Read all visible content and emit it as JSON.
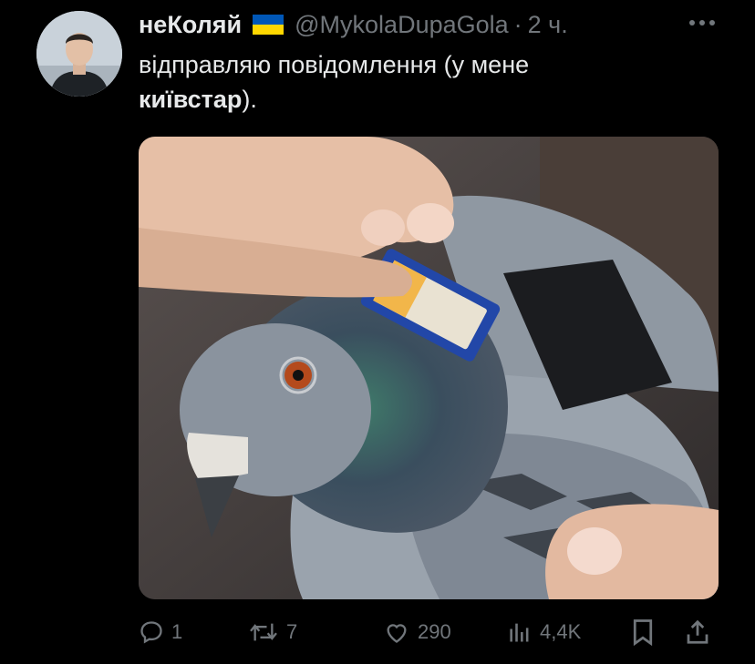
{
  "tweet": {
    "author": {
      "display_name": "неКоляй",
      "flag_icon": "ukraine-flag",
      "handle": "@MykolaDupaGola",
      "separator": "·",
      "time": "2 ч.",
      "avatar_icon": "user-avatar"
    },
    "text": {
      "part1": "відправляю повідомлення (у мене ",
      "bold": "київстар",
      "part2": ")."
    },
    "media": {
      "image_icon": "photo"
    },
    "actions": {
      "reply_count": "1",
      "retweet_count": "7",
      "like_count": "290",
      "views_count": "4,4K",
      "icons": [
        "reply-icon",
        "retweet-icon",
        "like-icon",
        "views-icon",
        "bookmark-icon",
        "share-icon"
      ]
    }
  },
  "colors": {
    "background": "#000000",
    "text_primary": "#e7e9ea",
    "text_secondary": "#71767b",
    "flag_blue": "#0057b7",
    "flag_yellow": "#ffd700"
  }
}
